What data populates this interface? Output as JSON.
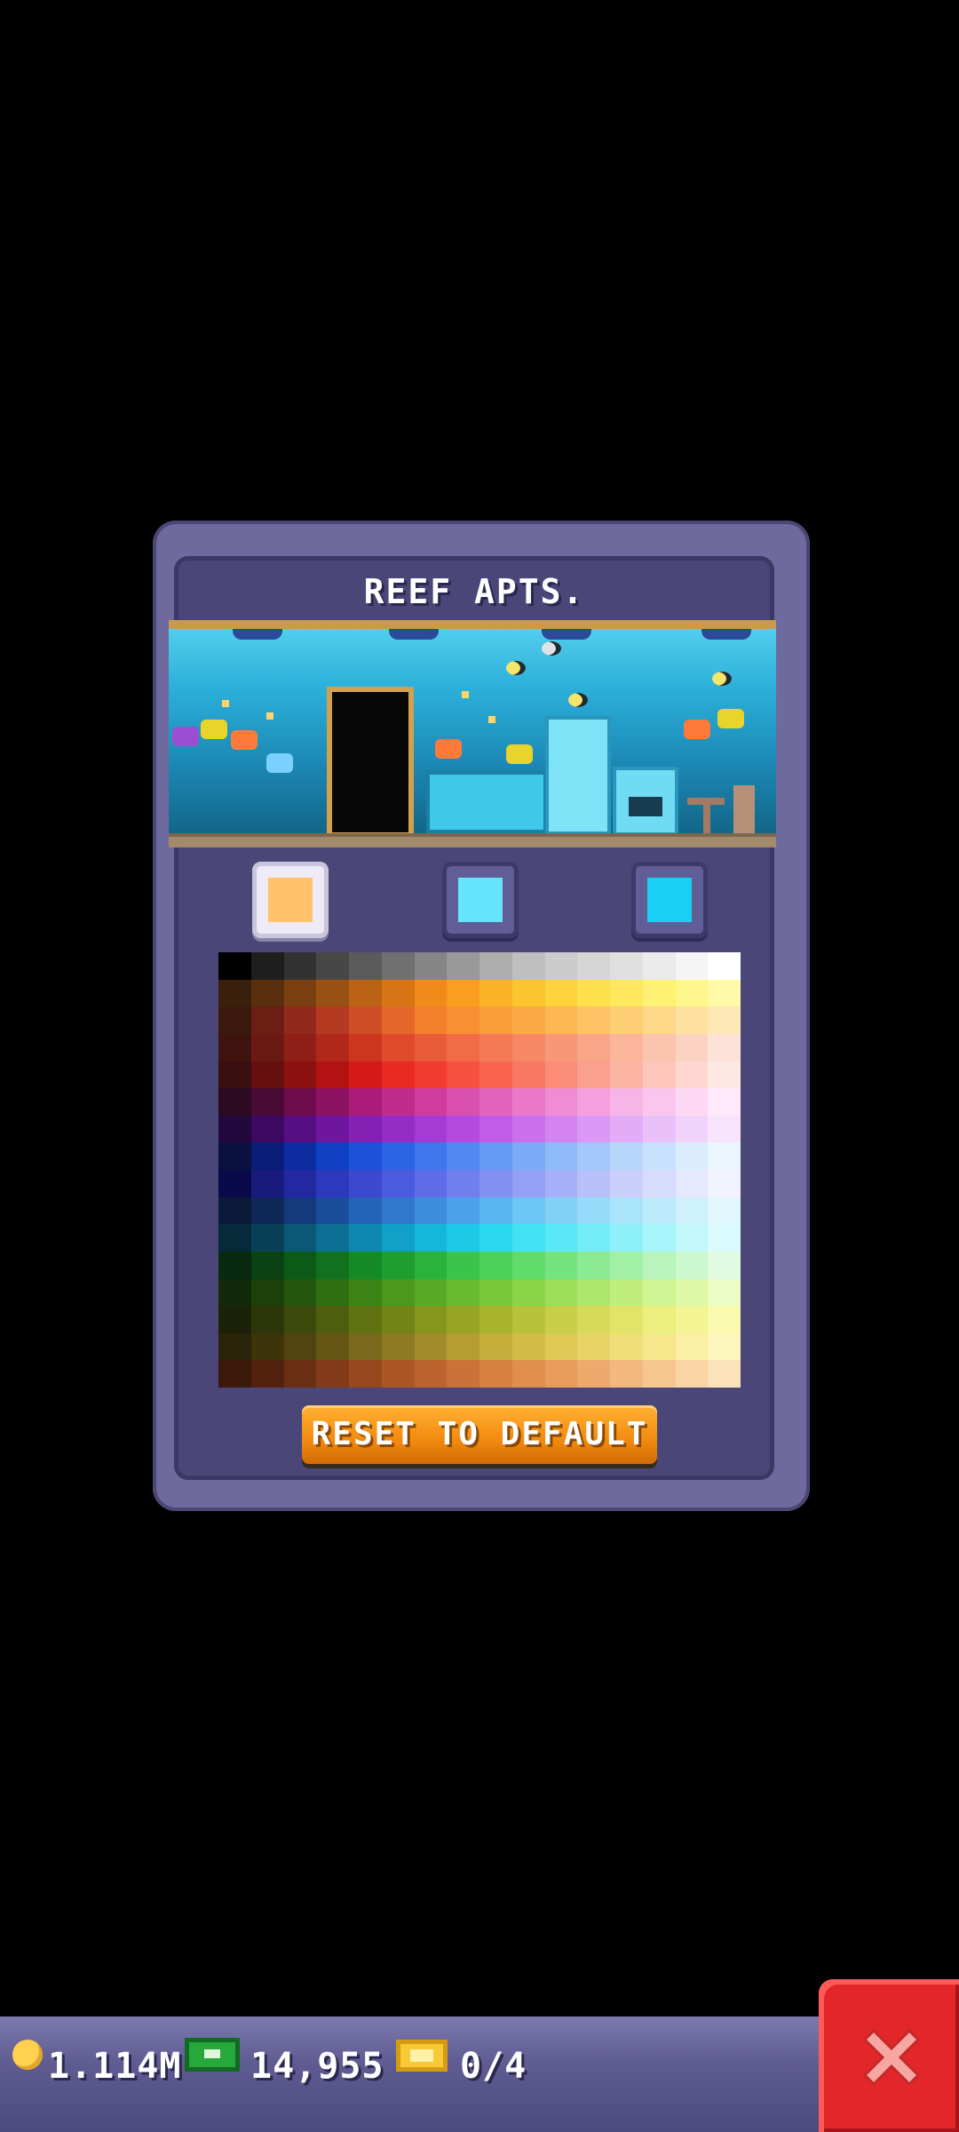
{
  "dialog": {
    "title": "REEF APTS.",
    "reset_label": "RESET TO DEFAULT"
  },
  "color_slots": [
    {
      "color": "#ffc46b",
      "selected": true
    },
    {
      "color": "#66e4fb",
      "selected": false
    },
    {
      "color": "#19d0f4",
      "selected": false
    }
  ],
  "palette_rows": [
    [
      "#000000",
      "#1e1e1e",
      "#323232",
      "#474747",
      "#5b5b5b",
      "#707070",
      "#858585",
      "#999999",
      "#adadad",
      "#bfbfbf",
      "#cccccc",
      "#d6d6d6",
      "#e0e0e0",
      "#ebebeb",
      "#f5f5f5",
      "#ffffff"
    ],
    [
      "#3a1f0b",
      "#5a2f0d",
      "#7a3f10",
      "#9a5012",
      "#ba6314",
      "#d77516",
      "#f08a18",
      "#f99e1e",
      "#fbb326",
      "#fcc42f",
      "#fdd33c",
      "#fde04c",
      "#fee95e",
      "#fef174",
      "#fff68c",
      "#fff9a8"
    ],
    [
      "#3b1a0d",
      "#6a1e14",
      "#922a1c",
      "#b43a22",
      "#cd4d26",
      "#e3662a",
      "#f27f2c",
      "#f88f32",
      "#fa9d3b",
      "#fbaa47",
      "#fcb654",
      "#fdc263",
      "#fdce74",
      "#fed888",
      "#fee19e",
      "#fee9b6"
    ],
    [
      "#3f140f",
      "#6a1a13",
      "#8f1f17",
      "#b1281b",
      "#cc351e",
      "#de4a2a",
      "#e85c38",
      "#f06b46",
      "#f47a56",
      "#f68866",
      "#f89777",
      "#f9a688",
      "#fab59b",
      "#fbc4ae",
      "#fcd3c3",
      "#fde2d8"
    ],
    [
      "#3a0f0f",
      "#650f0f",
      "#8c1010",
      "#b41212",
      "#d41a18",
      "#e82a24",
      "#f23c32",
      "#f65040",
      "#f86450",
      "#f97864",
      "#fa8c78",
      "#fba08e",
      "#fcb4a4",
      "#fdc6ba",
      "#fed8d0",
      "#fee8e4"
    ],
    [
      "#2c0a22",
      "#4a0a36",
      "#6e0c4c",
      "#8e1262",
      "#aa1c78",
      "#bf2c8c",
      "#cf3c9e",
      "#da50ae",
      "#e364bc",
      "#ea78c8",
      "#f08cd3",
      "#f4a0dd",
      "#f7b4e6",
      "#fac6ee",
      "#fcd8f4",
      "#fee8f9"
    ],
    [
      "#22083c",
      "#3c0a62",
      "#560e82",
      "#6e169e",
      "#8420b4",
      "#962cc6",
      "#a63ad4",
      "#b44ade",
      "#c05ce6",
      "#ca70ec",
      "#d384f0",
      "#db98f4",
      "#e3acf6",
      "#eac0f8",
      "#f1d2fa",
      "#f7e4fc"
    ],
    [
      "#0a1040",
      "#0b1c76",
      "#0d2ca2",
      "#1240c4",
      "#1c52da",
      "#2c64e6",
      "#3e76ee",
      "#5288f2",
      "#669af6",
      "#7aaaf8",
      "#8ebafa",
      "#a2c8fb",
      "#b6d6fc",
      "#c8e2fd",
      "#daecfe",
      "#ebf5ff"
    ],
    [
      "#0a0a4a",
      "#181a7c",
      "#2228a0",
      "#2e38bc",
      "#3c48d0",
      "#4c5ade",
      "#5e6ce8",
      "#707eee",
      "#8290f2",
      "#94a0f6",
      "#a6b0f8",
      "#b8c0fa",
      "#cad0fb",
      "#d8dcfc",
      "#e6e8fd",
      "#f2f3fe"
    ],
    [
      "#0c1a3a",
      "#0f2858",
      "#133a7a",
      "#1a4e9a",
      "#2464b6",
      "#3078cc",
      "#3e8ede",
      "#4ca2ea",
      "#5cb6f2",
      "#6ec6f6",
      "#82d2f8",
      "#96dcfa",
      "#aae4fb",
      "#bcebfc",
      "#ceF1fd",
      "#e0f7fe"
    ],
    [
      "#062a3a",
      "#084058",
      "#0a5876",
      "#0c7094",
      "#0e88b0",
      "#10a0c8",
      "#14b6da",
      "#1ccae8",
      "#2cd8f0",
      "#42e2f4",
      "#5ae8f6",
      "#74edf8",
      "#8ef1fa",
      "#a8f5fb",
      "#c2f8fc",
      "#dafbfe"
    ],
    [
      "#072a10",
      "#0a4214",
      "#0c5a18",
      "#10721e",
      "#168a26",
      "#1e9e30",
      "#2ab23c",
      "#3ac44a",
      "#4cd25a",
      "#60dc6c",
      "#76e47e",
      "#8cea92",
      "#a2f0a6",
      "#b8f4bc",
      "#ccf8d0",
      "#e0fbe2"
    ],
    [
      "#12290a",
      "#1c400c",
      "#26570e",
      "#306e12",
      "#3c8416",
      "#4a981c",
      "#58aa24",
      "#68ba2e",
      "#78c83a",
      "#8ad448",
      "#9cde58",
      "#aee66a",
      "#c0ee7e",
      "#cff494",
      "#def8aa",
      "#ebfcc4"
    ],
    [
      "#1c2208",
      "#2c360a",
      "#3c4a0c",
      "#4e5e0e",
      "#607212",
      "#728416",
      "#84961c",
      "#96a624",
      "#a8b42e",
      "#b8c23a",
      "#c8ce48",
      "#d6da58",
      "#e2e46a",
      "#ecee7e",
      "#f4f494",
      "#fafaae"
    ],
    [
      "#2a2408",
      "#3e340a",
      "#524410",
      "#665616",
      "#7a681c",
      "#8e7a22",
      "#a28c2a",
      "#b49e32",
      "#c4ae3c",
      "#d2bc48",
      "#dec856",
      "#e8d466",
      "#f0de78",
      "#f6e78c",
      "#faefa2",
      "#fdf6bc"
    ],
    [
      "#3a180a",
      "#52220e",
      "#6a2e12",
      "#823a18",
      "#98481e",
      "#ac5626",
      "#bc642e",
      "#ca7238",
      "#d68042",
      "#e08e4e",
      "#e89c5c",
      "#eeaa6c",
      "#f2b87e",
      "#f6c690",
      "#f9d4a4",
      "#fce2ba"
    ]
  ],
  "status_bar": {
    "coins": "1.114M",
    "cash": "14,955",
    "tickets": "0/4"
  },
  "icons": {
    "coin": "coin-icon",
    "cash": "cash-icon",
    "ticket": "ticket-icon",
    "close": "close-icon"
  }
}
